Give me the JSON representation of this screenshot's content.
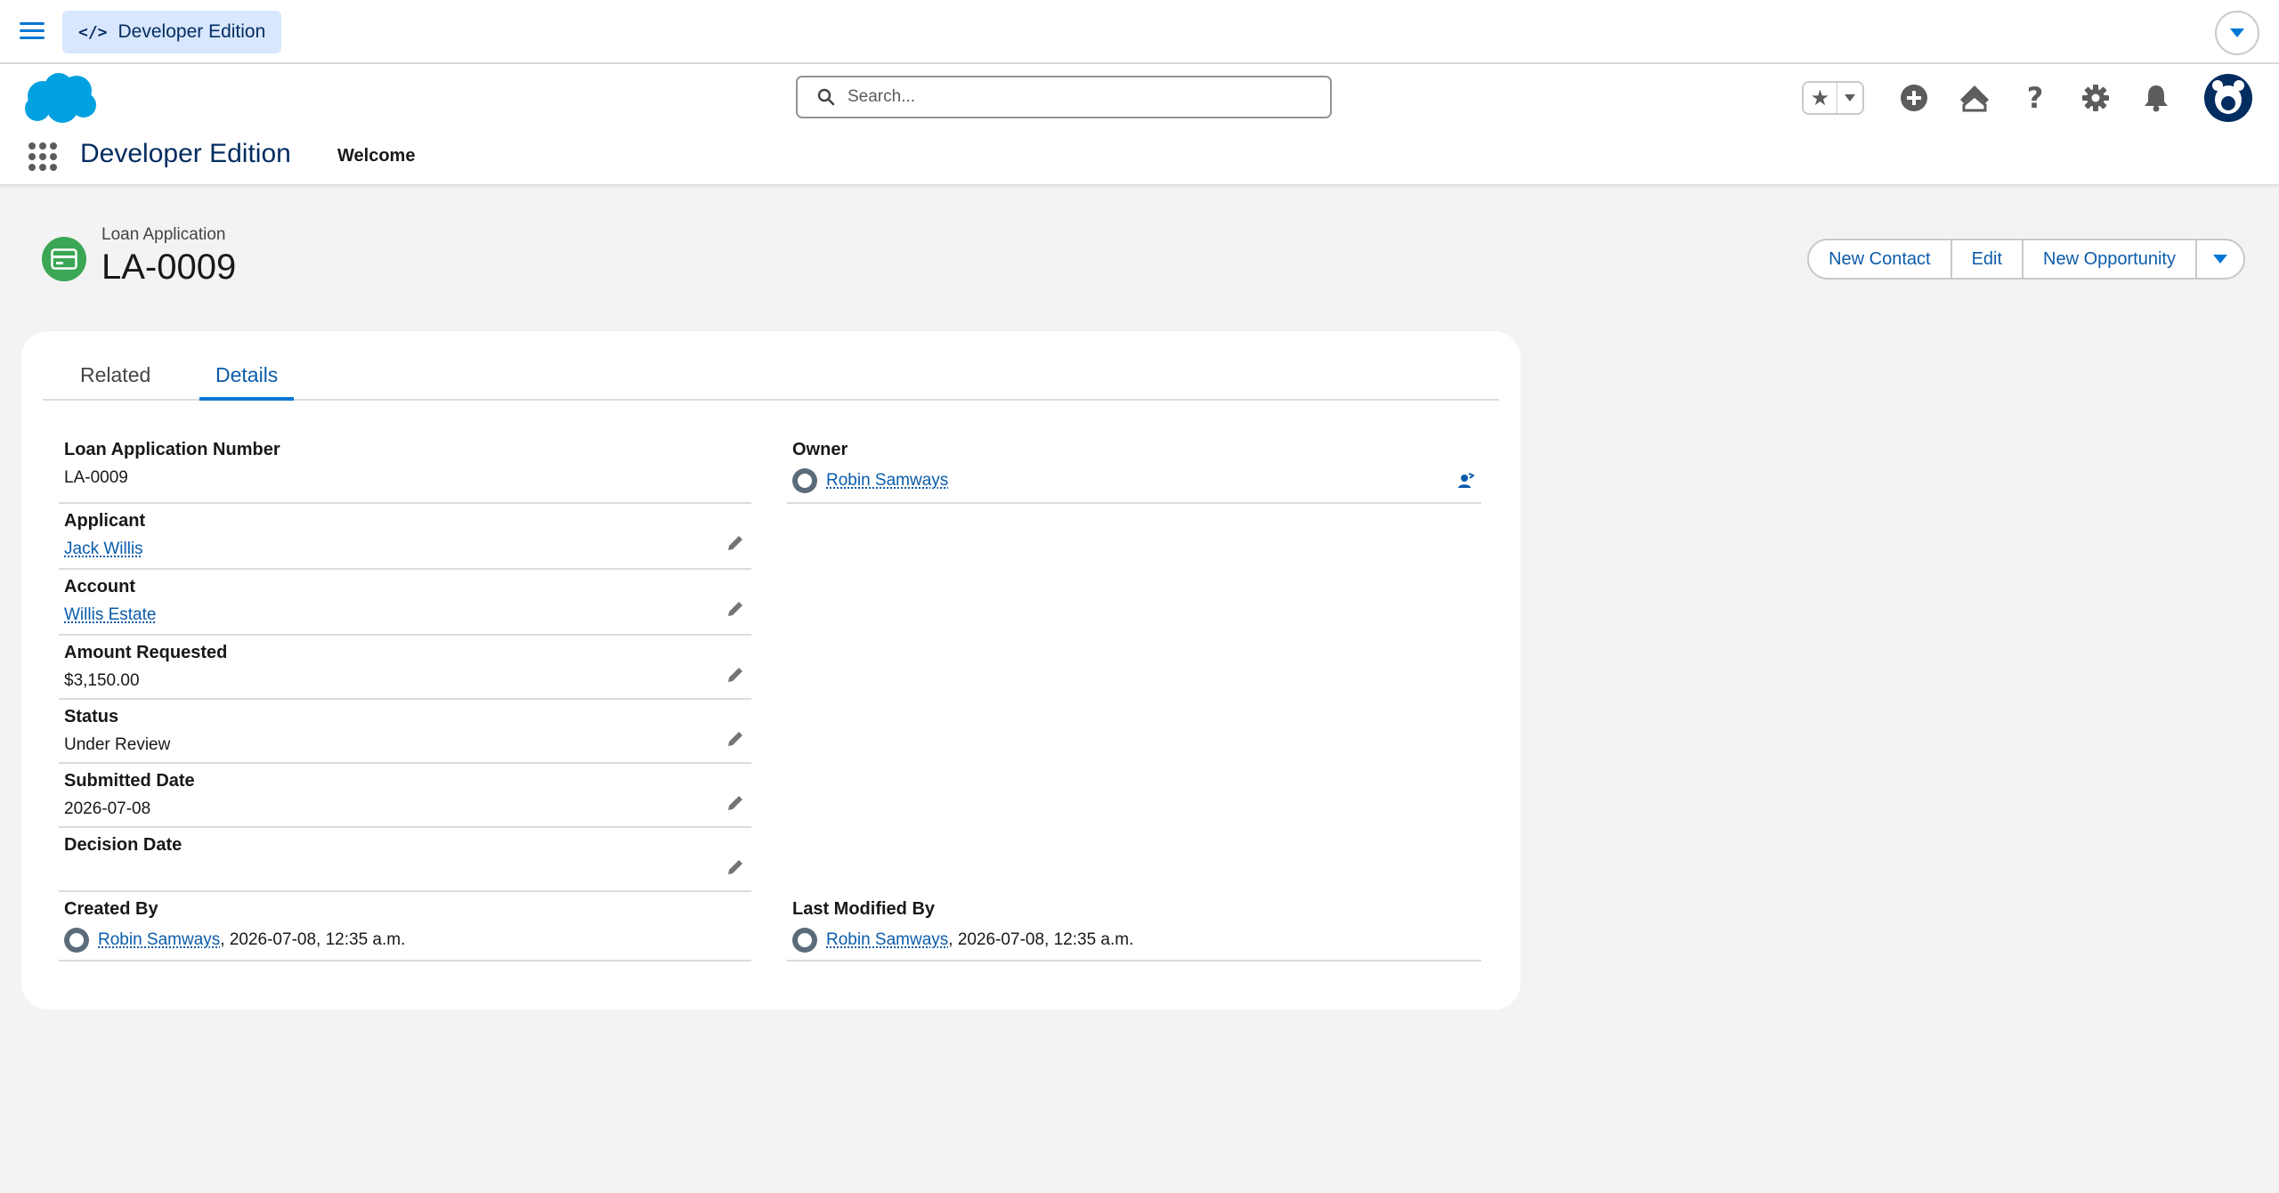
{
  "devbar": {
    "edition_label": "Developer Edition"
  },
  "header": {
    "search_placeholder": "Search...",
    "app_name": "Developer Edition",
    "nav_items": [
      "Welcome"
    ]
  },
  "record": {
    "object_type": "Loan Application",
    "title": "LA-0009",
    "actions": [
      "New Contact",
      "Edit",
      "New Opportunity"
    ]
  },
  "tabs": [
    "Related",
    "Details"
  ],
  "active_tab": "Details",
  "fields": {
    "loan_number": {
      "label": "Loan Application Number",
      "value": "LA-0009"
    },
    "owner": {
      "label": "Owner",
      "value": "Robin Samways"
    },
    "applicant": {
      "label": "Applicant",
      "value": "Jack Willis"
    },
    "account": {
      "label": "Account",
      "value": "Willis Estate"
    },
    "amount": {
      "label": "Amount Requested",
      "value": "$3,150.00"
    },
    "status": {
      "label": "Status",
      "value": "Under Review"
    },
    "submitted": {
      "label": "Submitted Date",
      "value": "2026-07-08"
    },
    "decision": {
      "label": "Decision Date",
      "value": ""
    },
    "created_by": {
      "label": "Created By",
      "user": "Robin Samways",
      "timestamp": ", 2026-07-08, 12:35 a.m."
    },
    "modified_by": {
      "label": "Last Modified By",
      "user": "Robin Samways",
      "timestamp": ", 2026-07-08, 12:35 a.m."
    }
  },
  "colors": {
    "brand": "#0176d3",
    "link": "#0b5cab",
    "record_icon": "#3ba755",
    "cloud": "#00a1e0"
  }
}
